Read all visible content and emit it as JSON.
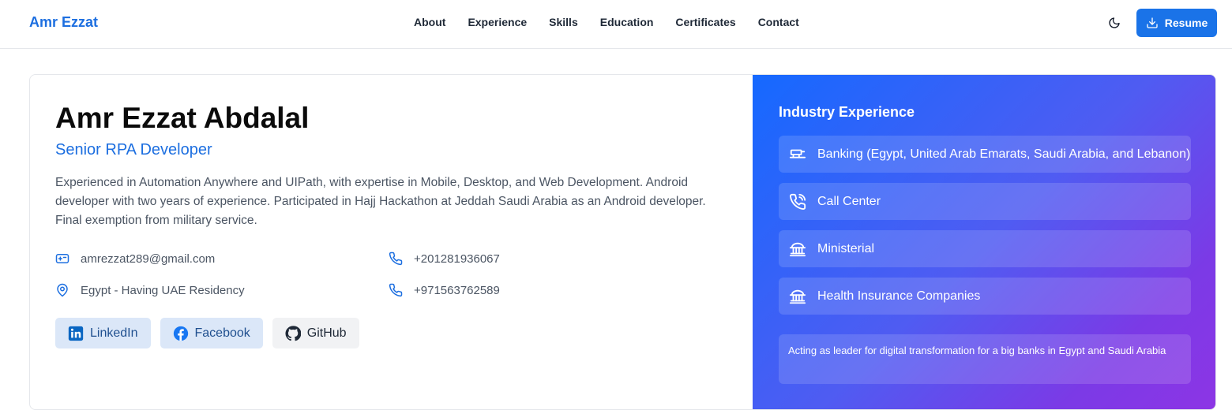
{
  "nav": {
    "brand": "Amr Ezzat",
    "links": [
      "About",
      "Experience",
      "Skills",
      "Education",
      "Certificates",
      "Contact"
    ],
    "theme_icon": "moon-icon",
    "resume_label": "Resume",
    "resume_icon": "download-icon"
  },
  "profile": {
    "name": "Amr Ezzat Abdalal",
    "title": "Senior RPA Developer",
    "bio": "Experienced in Automation Anywhere and UIPath, with expertise in Mobile, Desktop, and Web Development. Android developer with two years of experience. Participated in Hajj Hackathon at Jeddah Saudi Arabia as an Android developer. Final exemption from military service.",
    "email": "amrezzat289@gmail.com",
    "location": "Egypt - Having UAE Residency",
    "phone1": "+201281936067",
    "phone2": "+971563762589",
    "socials": {
      "linkedin": "LinkedIn",
      "facebook": "Facebook",
      "github": "GitHub"
    }
  },
  "industry": {
    "title": "Industry Experience",
    "items": [
      {
        "label": "Banking (Egypt, United Arab Emarats, Saudi Arabia, and Lebanon)",
        "icon": "bank-icon"
      },
      {
        "label": "Call Center",
        "icon": "phone-call-icon"
      },
      {
        "label": "Ministerial",
        "icon": "building-icon"
      },
      {
        "label": "Health Insurance Companies",
        "icon": "building-icon"
      }
    ],
    "note": "Acting as leader for digital transformation for a big banks in Egypt and Saudi Arabia"
  },
  "colors": {
    "accent": "#1a73e8",
    "gradient_start": "#1569ff",
    "gradient_end": "#8d35e5"
  }
}
